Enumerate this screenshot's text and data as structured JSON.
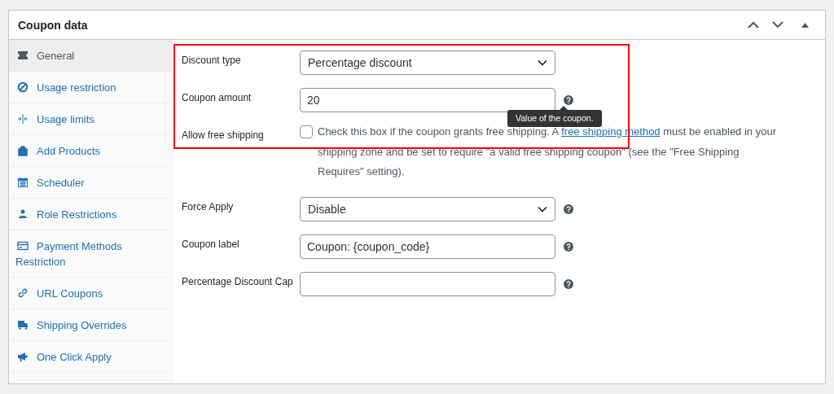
{
  "panel": {
    "title": "Coupon data"
  },
  "tabs": [
    {
      "label": "General",
      "selected": true
    },
    {
      "label": "Usage restriction",
      "selected": false
    },
    {
      "label": "Usage limits",
      "selected": false
    },
    {
      "label": "Add Products",
      "selected": false
    },
    {
      "label": "Scheduler",
      "selected": false
    },
    {
      "label": "Role Restrictions",
      "selected": false
    },
    {
      "label": "Payment Methods Restriction",
      "selected": false
    },
    {
      "label": "URL Coupons",
      "selected": false
    },
    {
      "label": "Shipping Overrides",
      "selected": false
    },
    {
      "label": "One Click Apply",
      "selected": false
    }
  ],
  "fields": [
    {
      "kind": "select",
      "label": "Discount type",
      "value": "Percentage discount",
      "help": false,
      "highlighted": true
    },
    {
      "kind": "text",
      "label": "Coupon amount",
      "value": "20",
      "help": true,
      "highlighted": true,
      "tooltip": "Value of the coupon."
    },
    {
      "kind": "checkbox",
      "label": "Allow free shipping",
      "checked": false,
      "highlighted": true,
      "description_before": "Check this box if the coupon grants free shipping. A ",
      "link": "free shipping method",
      "description_after": " must be enabled in your shipping zone and be set to require \"a valid free shipping coupon\" (see the \"Free Shipping Requires\" setting)."
    },
    {
      "kind": "select",
      "label": "Force Apply",
      "value": "Disable",
      "help": true,
      "highlighted": false
    },
    {
      "kind": "text",
      "label": "Coupon label",
      "value": "Coupon: {coupon_code}",
      "help": true,
      "highlighted": false
    },
    {
      "kind": "text",
      "label": "Percentage Discount Cap",
      "help": true,
      "highlighted": false
    }
  ]
}
